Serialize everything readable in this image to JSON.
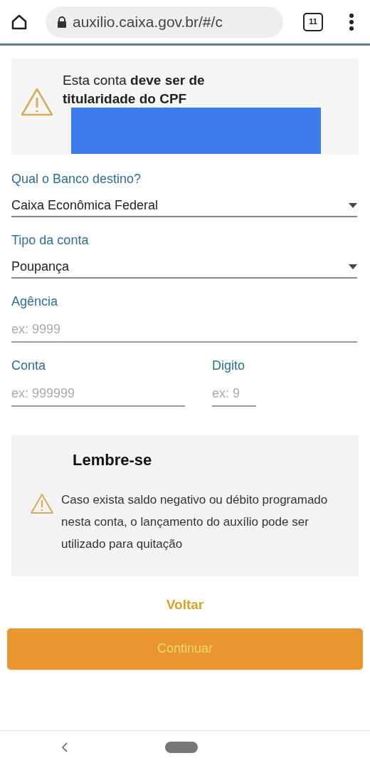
{
  "browser": {
    "url": "auxilio.caixa.gov.br/#/c",
    "tab_count": "11"
  },
  "notice": {
    "text": "Esta conta **deve ser de titularidade do CPF**",
    "redacted": true
  },
  "field_rows": [
    {
      "fields": [
        {
          "kind": "select",
          "label": "Qual o Banco destino?",
          "value": "Caixa Econômica Federal"
        }
      ]
    },
    {
      "fields": [
        {
          "kind": "select",
          "label": "Tipo da conta",
          "value": "Poupança"
        }
      ]
    },
    {
      "fields": [
        {
          "kind": "input",
          "label": "Agência",
          "placeholder": "ex: 9999"
        }
      ]
    },
    {
      "fields": [
        {
          "kind": "input",
          "label": "Conta",
          "placeholder": "ex: 999999"
        },
        {
          "kind": "input",
          "label": "Digito",
          "placeholder": "ex: 9"
        }
      ]
    }
  ],
  "reminder": {
    "title": "Lembre-se",
    "text": "Caso exista saldo negativo ou débito programado nesta conta, o lançamento do auxílio pode ser utilizado para quitação"
  },
  "buttons": [
    {
      "kind": "link",
      "label": "Voltar"
    },
    {
      "kind": "primary",
      "label": "Continuar"
    }
  ]
}
